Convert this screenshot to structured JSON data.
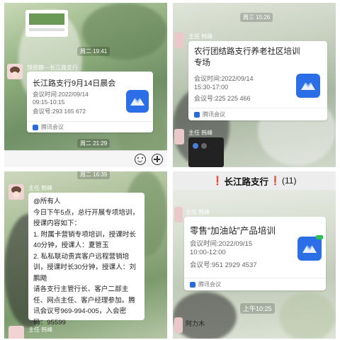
{
  "p1": {
    "sender": "钱依静—长江路支行",
    "time_top": "周二 19:41",
    "card": {
      "title": "长江路支行9月14日晨会",
      "date": "会议时间:2022/09/14",
      "time": "09:15-10:15",
      "id": "会议号:293 165 672",
      "footer": "腾讯会议"
    },
    "time_bottom": "周二 21:29"
  },
  "p2": {
    "time_top": "周三 15:26",
    "sender": "主任  韩峰",
    "card": {
      "title": "农行团结路支行养老社区培训专场",
      "date": "会议时间:2022/09/14",
      "time": "15:30-17:00",
      "id": "会议号:225 225 466",
      "footer": "腾讯会议"
    },
    "sender2": "主任  韩峰"
  },
  "p3": {
    "time_top": "周二 16:39",
    "sender": "主任  韩峰",
    "message": "@所有人\n今日下午5点，总行开展专项培训，授课内容如下：\n1. 附属卡营销专项培训，授课时长40分钟，授课人：夏管玉\n2. 私私联动贵宾客户远程营销培训，授课时长30分钟，授课人：刘鹏飏\n请各支行主管行长、客户二部主任、网点主任、客户经理参加。腾讯会议号969-994-005，入会密码：95599",
    "sender_bottom": "主任  韩峰"
  },
  "p4": {
    "header_title": "长江路支行",
    "header_count": "(11)",
    "sender": "主任  韩峰",
    "card": {
      "title": "零售“加油站”产品培训",
      "date": "会议时间:2022/09/15",
      "time": "10:00-12:00",
      "id": "会议号:951 2929 4537",
      "footer": "腾讯会议"
    },
    "time_bottom": "上午10:25",
    "sender_bottom": "阿力木"
  }
}
